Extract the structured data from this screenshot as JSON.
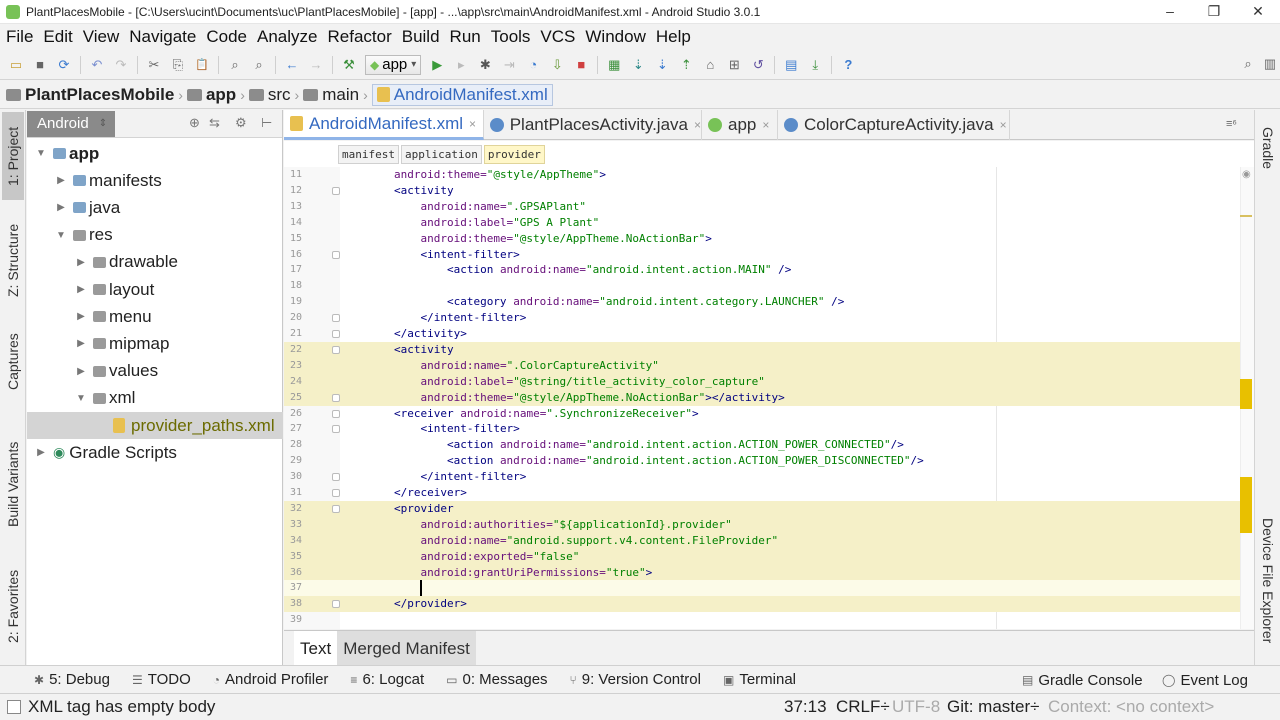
{
  "window": {
    "title": "PlantPlacesMobile - [C:\\Users\\ucint\\Documents\\uc\\PlantPlacesMobile] - [app] - ...\\app\\src\\main\\AndroidManifest.xml - Android Studio 3.0.1",
    "minimize": "–",
    "maximize": "❐",
    "close": "✕"
  },
  "menu": [
    "File",
    "Edit",
    "View",
    "Navigate",
    "Code",
    "Analyze",
    "Refactor",
    "Build",
    "Run",
    "Tools",
    "VCS",
    "Window",
    "Help"
  ],
  "toolbar": {
    "run_config": "app",
    "run_config_arrow": "▾",
    "icons": {
      "open": "▭",
      "save": "■",
      "sync": "⟳",
      "undo": "↶",
      "redo": "↷",
      "cut": "✂",
      "copy": "⎘",
      "paste": "📋",
      "find": "⌕",
      "replace": "⌕",
      "back": "←",
      "forward": "→",
      "build": "⚒",
      "run": "▶",
      "run_disabled": "▸",
      "debug": "✱",
      "attach": "⇥",
      "profile": "◔",
      "apply_changes": "⇩",
      "stop": "■",
      "avd_manager": "▦",
      "sdk_manager": "⇣",
      "vcs_update": "⇣",
      "vcs_commit": "⇡",
      "vcs_history": "⌂",
      "vcs_compare": "⊞",
      "vcs_revert": "↺",
      "project_structure": "▤",
      "sdk_download": "⤓",
      "help": "?",
      "search": "⌕",
      "layout": "▥"
    }
  },
  "navbar": {
    "crumbs": [
      "PlantPlacesMobile",
      "app",
      "src",
      "main",
      "AndroidManifest.xml"
    ],
    "separator": "›"
  },
  "left_strip": [
    "1: Project",
    "Z: Structure",
    "Captures",
    "Build Variants",
    "2: Favorites"
  ],
  "right_strip": [
    "Gradle",
    "Device File Explorer"
  ],
  "project_panel": {
    "view": "Android",
    "view_arrow": "⇕",
    "header_icons": {
      "sync": "⊕",
      "settings": "⚙",
      "collapse": "⊢",
      "scroll": "⇆"
    },
    "tree": [
      {
        "label": "app",
        "level": 0,
        "expanded": true,
        "bold": true,
        "icon": "folder"
      },
      {
        "label": "manifests",
        "level": 1,
        "expanded": false,
        "icon": "folder"
      },
      {
        "label": "java",
        "level": 1,
        "expanded": false,
        "icon": "folder"
      },
      {
        "label": "res",
        "level": 1,
        "expanded": true,
        "icon": "res-folder"
      },
      {
        "label": "drawable",
        "level": 2,
        "expanded": false,
        "icon": "gray-folder"
      },
      {
        "label": "layout",
        "level": 2,
        "expanded": false,
        "icon": "gray-folder"
      },
      {
        "label": "menu",
        "level": 2,
        "expanded": false,
        "icon": "gray-folder"
      },
      {
        "label": "mipmap",
        "level": 2,
        "expanded": false,
        "icon": "gray-folder"
      },
      {
        "label": "values",
        "level": 2,
        "expanded": false,
        "icon": "gray-folder"
      },
      {
        "label": "xml",
        "level": 2,
        "expanded": true,
        "icon": "gray-folder"
      },
      {
        "label": "provider_paths.xml",
        "level": 3,
        "leaf": true,
        "selected": true,
        "icon": "xml-file"
      },
      {
        "label": "Gradle Scripts",
        "level": 0,
        "expanded": false,
        "icon": "gradle"
      }
    ]
  },
  "editor_tabs": [
    {
      "label": "AndroidManifest.xml",
      "icon": "xml",
      "active": true
    },
    {
      "label": "PlantPlacesActivity.java",
      "icon": "java",
      "active": false
    },
    {
      "label": "app",
      "icon": "app",
      "active": false
    },
    {
      "label": "ColorCaptureActivity.java",
      "icon": "java",
      "active": false
    }
  ],
  "editor_tabs_overflow": "≡⁶",
  "tab_close": "×",
  "tag_breadcrumbs": [
    "manifest",
    "application",
    "provider"
  ],
  "code": [
    {
      "n": "11",
      "indent": 8,
      "hl": false,
      "parts": [
        [
          "attr",
          "android:theme="
        ],
        [
          "str",
          "\"@style/AppTheme\""
        ],
        [
          "tag",
          ">"
        ]
      ]
    },
    {
      "n": "12",
      "indent": 8,
      "hl": false,
      "fold": true,
      "parts": [
        [
          "tag",
          "<activity"
        ]
      ]
    },
    {
      "n": "13",
      "indent": 12,
      "hl": false,
      "parts": [
        [
          "attr",
          "android:name="
        ],
        [
          "str",
          "\".GPSAPlant\""
        ]
      ]
    },
    {
      "n": "14",
      "indent": 12,
      "hl": false,
      "parts": [
        [
          "attr",
          "android:label="
        ],
        [
          "str",
          "\"GPS A Plant\""
        ]
      ]
    },
    {
      "n": "15",
      "indent": 12,
      "hl": false,
      "parts": [
        [
          "attr",
          "android:theme="
        ],
        [
          "str",
          "\"@style/AppTheme.NoActionBar\""
        ],
        [
          "tag",
          ">"
        ]
      ]
    },
    {
      "n": "16",
      "indent": 12,
      "hl": false,
      "fold": true,
      "parts": [
        [
          "tag",
          "<intent-filter>"
        ]
      ]
    },
    {
      "n": "17",
      "indent": 16,
      "hl": false,
      "parts": [
        [
          "tag",
          "<action "
        ],
        [
          "attr",
          "android:name="
        ],
        [
          "str",
          "\"android.intent.action.MAIN\""
        ],
        [
          "tag",
          " />"
        ]
      ]
    },
    {
      "n": "18",
      "indent": 0,
      "hl": false,
      "parts": []
    },
    {
      "n": "19",
      "indent": 16,
      "hl": false,
      "parts": [
        [
          "tag",
          "<category "
        ],
        [
          "attr",
          "android:name="
        ],
        [
          "str",
          "\"android.intent.category.LAUNCHER\""
        ],
        [
          "tag",
          " />"
        ]
      ]
    },
    {
      "n": "20",
      "indent": 12,
      "hl": false,
      "fold": true,
      "parts": [
        [
          "tag",
          "</intent-filter>"
        ]
      ]
    },
    {
      "n": "21",
      "indent": 8,
      "hl": false,
      "fold": true,
      "parts": [
        [
          "tag",
          "</activity>"
        ]
      ]
    },
    {
      "n": "22",
      "indent": 8,
      "hl": true,
      "fold": true,
      "parts": [
        [
          "tag",
          "<activity"
        ]
      ]
    },
    {
      "n": "23",
      "indent": 12,
      "hl": true,
      "parts": [
        [
          "attr",
          "android:name="
        ],
        [
          "str",
          "\".ColorCaptureActivity\""
        ]
      ]
    },
    {
      "n": "24",
      "indent": 12,
      "hl": true,
      "parts": [
        [
          "attr",
          "android:label="
        ],
        [
          "str",
          "\"@string/title_activity_color_capture\""
        ]
      ]
    },
    {
      "n": "25",
      "indent": 12,
      "hl": true,
      "fold": true,
      "parts": [
        [
          "attr",
          "android:theme="
        ],
        [
          "str",
          "\"@style/AppTheme.NoActionBar\""
        ],
        [
          "tag",
          "></activity>"
        ]
      ]
    },
    {
      "n": "26",
      "indent": 8,
      "hl": false,
      "fold": true,
      "parts": [
        [
          "tag",
          "<receiver "
        ],
        [
          "attr",
          "android:name="
        ],
        [
          "str",
          "\".SynchronizeReceiver\""
        ],
        [
          "tag",
          ">"
        ]
      ]
    },
    {
      "n": "27",
      "indent": 12,
      "hl": false,
      "fold": true,
      "parts": [
        [
          "tag",
          "<intent-filter>"
        ]
      ]
    },
    {
      "n": "28",
      "indent": 16,
      "hl": false,
      "parts": [
        [
          "tag",
          "<action "
        ],
        [
          "attr",
          "android:name="
        ],
        [
          "str",
          "\"android.intent.action.ACTION_POWER_CONNECTED\""
        ],
        [
          "tag",
          "/>"
        ]
      ]
    },
    {
      "n": "29",
      "indent": 16,
      "hl": false,
      "parts": [
        [
          "tag",
          "<action "
        ],
        [
          "attr",
          "android:name="
        ],
        [
          "str",
          "\"android.intent.action.ACTION_POWER_DISCONNECTED\""
        ],
        [
          "tag",
          "/>"
        ]
      ]
    },
    {
      "n": "30",
      "indent": 12,
      "hl": false,
      "fold": true,
      "parts": [
        [
          "tag",
          "</intent-filter>"
        ]
      ]
    },
    {
      "n": "31",
      "indent": 8,
      "hl": false,
      "fold": true,
      "parts": [
        [
          "tag",
          "</receiver>"
        ]
      ]
    },
    {
      "n": "32",
      "indent": 8,
      "hl": true,
      "fold": true,
      "parts": [
        [
          "tag",
          "<provider"
        ]
      ]
    },
    {
      "n": "33",
      "indent": 12,
      "hl": true,
      "parts": [
        [
          "attr",
          "android:authorities="
        ],
        [
          "str",
          "\"${applicationId}.provider\""
        ]
      ]
    },
    {
      "n": "34",
      "indent": 12,
      "hl": true,
      "parts": [
        [
          "attr",
          "android:name="
        ],
        [
          "str",
          "\"android.support.v4.content.FileProvider\""
        ]
      ]
    },
    {
      "n": "35",
      "indent": 12,
      "hl": true,
      "parts": [
        [
          "attr",
          "android:exported="
        ],
        [
          "str",
          "\"false\""
        ]
      ]
    },
    {
      "n": "36",
      "indent": 12,
      "hl": true,
      "parts": [
        [
          "attr",
          "android:grantUriPermissions="
        ],
        [
          "str",
          "\"true\""
        ],
        [
          "tag",
          ">"
        ]
      ]
    },
    {
      "n": "37",
      "indent": 12,
      "hl": true,
      "caret": true,
      "parts": []
    },
    {
      "n": "38",
      "indent": 8,
      "hl": true,
      "fold": true,
      "parts": [
        [
          "tag",
          "</provider>"
        ]
      ]
    },
    {
      "n": "39",
      "indent": 0,
      "hl": false,
      "parts": []
    }
  ],
  "editor_bottom_tabs": [
    "Text",
    "Merged Manifest"
  ],
  "tool_windows": [
    {
      "label": "5: Debug",
      "icon": "✱"
    },
    {
      "label": "TODO",
      "icon": "☰"
    },
    {
      "label": "Android Profiler",
      "icon": "◔"
    },
    {
      "label": "6: Logcat",
      "icon": "≡"
    },
    {
      "label": "0: Messages",
      "icon": "▭"
    },
    {
      "label": "9: Version Control",
      "icon": "⑂"
    },
    {
      "label": "Terminal",
      "icon": "▣"
    }
  ],
  "tool_windows_right": [
    {
      "label": "Gradle Console",
      "icon": "▤"
    },
    {
      "label": "Event Log",
      "icon": "◯"
    }
  ],
  "status": {
    "message": "XML tag has empty body",
    "position": "37:13",
    "line_sep": "CRLF÷",
    "encoding": "UTF-8",
    "vcs_branch": "Git: master÷",
    "context": "Context: <no context>"
  },
  "colors": {
    "tag": "#000080",
    "attr": "#660e7a",
    "string": "#008000",
    "highlight": "#f5f0c8",
    "marker": "#e8c000",
    "selection": "#d4d4d4"
  }
}
